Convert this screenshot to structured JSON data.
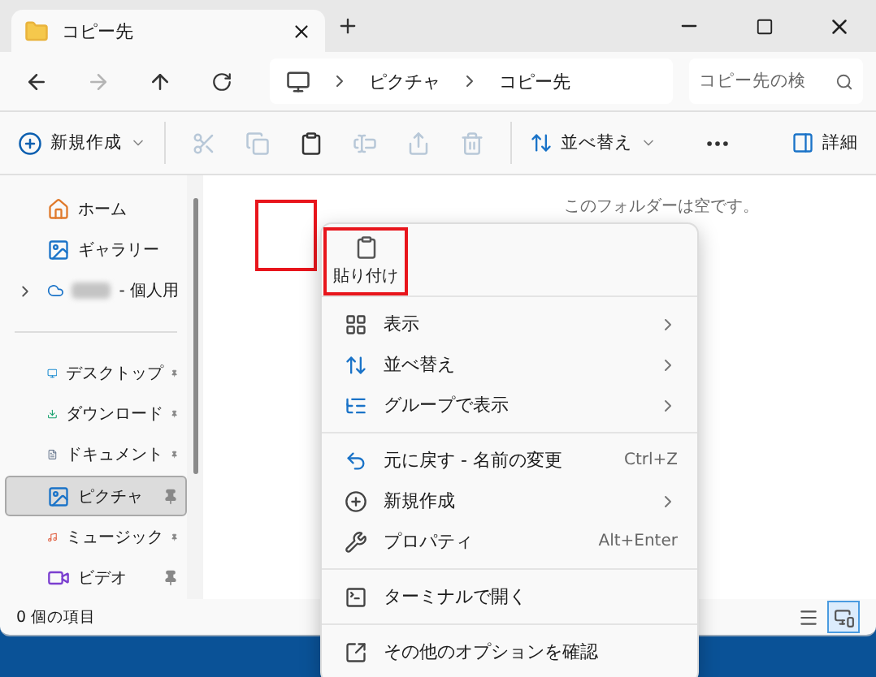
{
  "tab": {
    "title": "コピー先"
  },
  "address": {
    "crumbs": [
      "ピクチャ",
      "コピー先"
    ]
  },
  "search": {
    "placeholder": "コピー先の検"
  },
  "toolbar": {
    "new_label": "新規作成",
    "actions": [
      {
        "disabled": true
      },
      {
        "disabled": true
      },
      {
        "disabled": false
      },
      {
        "disabled": true
      },
      {
        "disabled": true
      },
      {
        "disabled": true
      }
    ],
    "sort_label": "並べ替え",
    "details_label": "詳細"
  },
  "sidebar": {
    "sections": [
      [
        {
          "label": "ホーム",
          "pinned": false,
          "selected": false,
          "expandable": false
        },
        {
          "label": "ギャラリー",
          "pinned": false,
          "selected": false,
          "expandable": false
        },
        {
          "label": "- 個人用",
          "pinned": false,
          "selected": false,
          "expandable": true,
          "kind": "blurred"
        }
      ],
      [
        {
          "label": "デスクトップ",
          "pinned": true,
          "selected": false,
          "expandable": false
        },
        {
          "label": "ダウンロード",
          "pinned": true,
          "selected": false,
          "expandable": false
        },
        {
          "label": "ドキュメント",
          "pinned": true,
          "selected": false,
          "expandable": false
        },
        {
          "label": "ピクチャ",
          "pinned": true,
          "selected": true,
          "expandable": false
        },
        {
          "label": "ミュージック",
          "pinned": true,
          "selected": false,
          "expandable": false
        },
        {
          "label": "ビデオ",
          "pinned": true,
          "selected": false,
          "expandable": false
        }
      ]
    ]
  },
  "content": {
    "empty_message": "このフォルダーは空です。"
  },
  "status_bar": {
    "text": "0 個の項目",
    "views": [
      {
        "selected": false
      },
      {
        "selected": true
      }
    ]
  },
  "context_menu": {
    "top_actions": [
      {
        "label": "貼り付け",
        "highlighted": true
      }
    ],
    "groups": [
      [
        {
          "label": "表示",
          "submenu": true
        },
        {
          "label": "並べ替え",
          "submenu": true
        },
        {
          "label": "グループで表示",
          "submenu": true
        }
      ],
      [
        {
          "label": "元に戻す - 名前の変更",
          "shortcut": "Ctrl+Z",
          "submenu": false
        },
        {
          "label": "新規作成",
          "submenu": true
        },
        {
          "label": "プロパティ",
          "shortcut": "Alt+Enter",
          "submenu": false
        }
      ],
      [
        {
          "label": "ターミナルで開く",
          "submenu": false
        }
      ],
      [
        {
          "label": "その他のオプションを確認",
          "submenu": false
        }
      ]
    ]
  }
}
